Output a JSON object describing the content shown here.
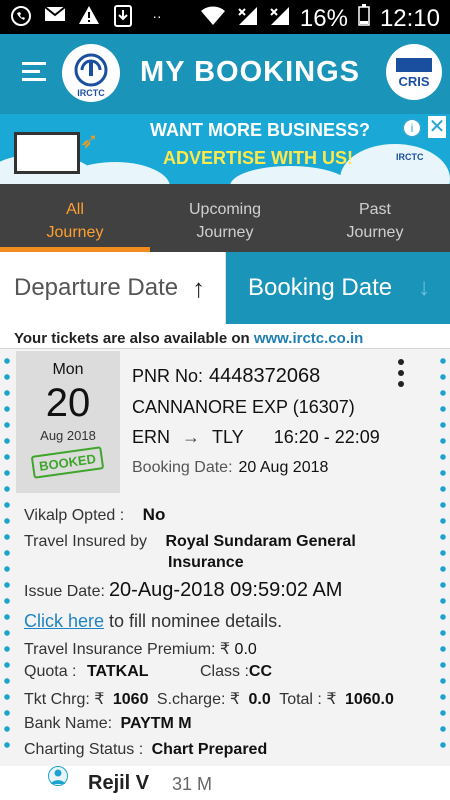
{
  "status_bar": {
    "battery": "16%",
    "time": "12:10",
    "icons": [
      "whatsapp-icon",
      "gmail-icon",
      "warning-icon",
      "download-icon",
      "more-dots-icon",
      "wifi-icon",
      "signal-x-icon",
      "signal-x-icon",
      "battery-icon"
    ]
  },
  "appbar": {
    "title": "MY BOOKINGS",
    "left_logo_text": "IRCTC",
    "right_logo_text": "CRIS"
  },
  "ad": {
    "line1": "WANT MORE BUSINESS?",
    "line2": "ADVERTISE WITH US!",
    "brand": "IRCTC",
    "info_glyph": "i",
    "close_glyph": "✕"
  },
  "tabs": [
    {
      "line1": "All",
      "line2": "Journey",
      "active": true
    },
    {
      "line1": "Upcoming",
      "line2": "Journey",
      "active": false
    },
    {
      "line1": "Past",
      "line2": "Journey",
      "active": false
    }
  ],
  "sort": {
    "departure_label": "Departure Date",
    "departure_arrow": "↑",
    "booking_label": "Booking Date",
    "booking_arrow": "↓"
  },
  "notice": {
    "text": "Your tickets are also available on",
    "link": "www.irctc.co.in"
  },
  "ticket": {
    "day": "Mon",
    "date": "20",
    "month_year": "Aug 2018",
    "stamp": "BOOKED",
    "pnr_label": "PNR No:",
    "pnr": "4448372068",
    "train": "CANNANORE EXP (16307)",
    "from": "ERN",
    "to": "TLY",
    "arrow": "→",
    "time": "16:20 - 22:09",
    "booking_date_label": "Booking Date:",
    "booking_date": "20 Aug 2018",
    "vikalp_label": "Vikalp Opted :",
    "vikalp": "No",
    "insured_label": "Travel Insured by",
    "insured_by": "Royal Sundaram General",
    "insured_by_2": "Insurance",
    "issue_label": "Issue Date:",
    "issue_date": "20-Aug-2018 09:59:02 AM",
    "click_link": "Click here",
    "click_text": "to fill nominee details.",
    "premium_label": "Travel Insurance Premium: ₹",
    "premium": "0.0",
    "quota_label": "Quota :",
    "quota": "TATKAL",
    "class_label": "Class :",
    "class": "CC",
    "tkt_label": "Tkt Chrg: ₹",
    "tkt": "1060",
    "scharge_label": "S.charge: ₹",
    "scharge": "0.0",
    "total_label": "Total : ₹",
    "total": "1060.0",
    "bank_label": "Bank Name:",
    "bank": "PAYTM M",
    "charting_label": "Charting Status :",
    "charting": "Chart Prepared"
  },
  "passenger": {
    "name": "Rejil V",
    "age_gender": "31 M"
  },
  "colors": {
    "primary": "#1a94b8",
    "tab_bg": "#414141",
    "tab_active": "#ff9f2e",
    "booked_stamp": "#3fa52c",
    "link": "#1f84c3"
  }
}
